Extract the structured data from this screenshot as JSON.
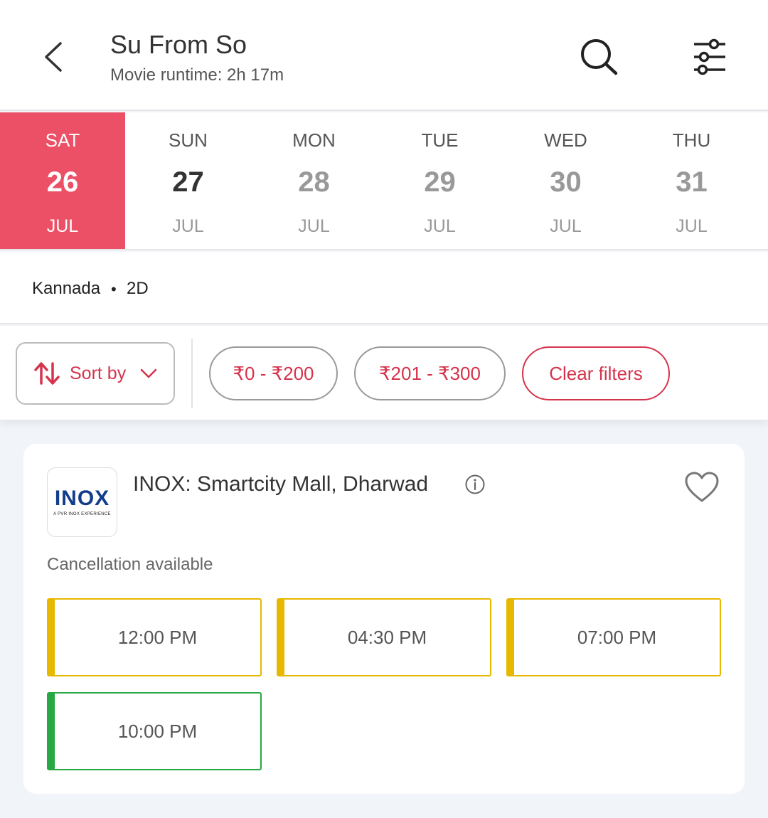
{
  "header": {
    "title": "Su From So",
    "subtitle": "Movie runtime: 2h 17m"
  },
  "dates": [
    {
      "dow": "SAT",
      "day": "26",
      "month": "JUL",
      "selected": true
    },
    {
      "dow": "SUN",
      "day": "27",
      "month": "JUL"
    },
    {
      "dow": "MON",
      "day": "28",
      "month": "JUL"
    },
    {
      "dow": "TUE",
      "day": "29",
      "month": "JUL"
    },
    {
      "dow": "WED",
      "day": "30",
      "month": "JUL"
    },
    {
      "dow": "THU",
      "day": "31",
      "month": "JUL"
    }
  ],
  "language": {
    "name": "Kannada",
    "separator": "•",
    "format": "2D"
  },
  "filters": {
    "sort_label": "Sort by",
    "price_1": "₹0 - ₹200",
    "price_2": "₹201 - ₹300",
    "clear": "Clear filters"
  },
  "cinema": {
    "logo_text": "INOX",
    "logo_subtext": "A PVR INOX EXPERIENCE",
    "name": "INOX: Smartcity Mall, Dharwad",
    "cancellation": "Cancellation available",
    "showtimes": [
      "12:00 PM",
      "04:30 PM",
      "07:00 PM",
      "10:00 PM"
    ]
  },
  "colors": {
    "accent": "#ec5066",
    "brand_red": "#d6334c",
    "show_amber": "#e6b800",
    "show_green": "#27a844"
  }
}
